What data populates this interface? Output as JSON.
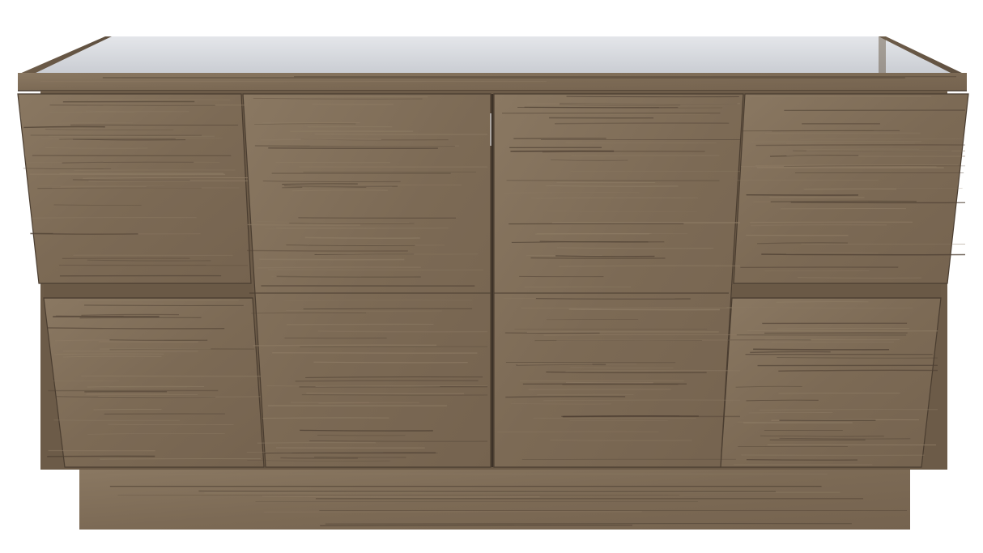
{
  "image": {
    "subject": "wood-grain-vanity-cabinet",
    "colors": {
      "background": "#ffffff",
      "wood_base": "#7c6a55",
      "wood_light": "#8d7b64",
      "wood_dark": "#5d4e3e",
      "grain_line": "#4e4033",
      "interior": "#d9dbdf",
      "interior_shadow": "#b9bcc2",
      "gap": "#3d3228"
    }
  }
}
